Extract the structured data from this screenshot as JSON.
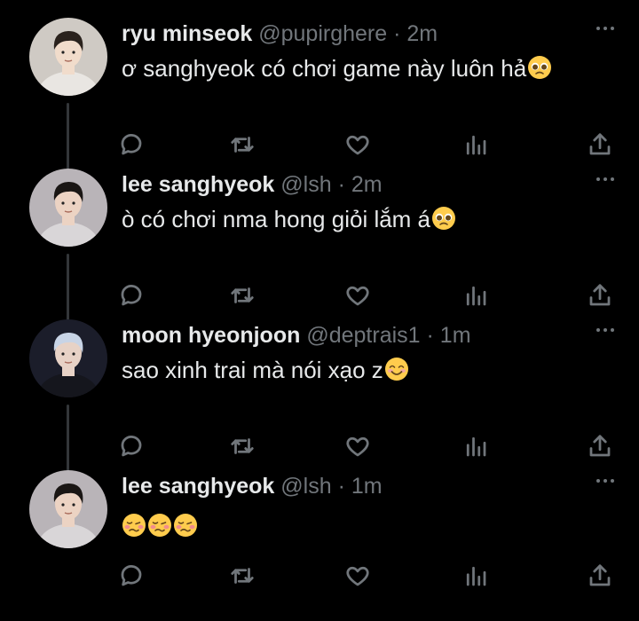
{
  "tweets": [
    {
      "display_name": "ryu minseok",
      "handle": "@pupirghere",
      "dot": "·",
      "time": "2m",
      "text": "ơ sanghyeok có chơi game này luôn hả",
      "emojis": [
        "pleading-face"
      ],
      "avatar_colors": {
        "bg": "#cfcac4",
        "hair": "#2a221d",
        "skin": "#f1dccb",
        "shirt": "#e9e6e2"
      }
    },
    {
      "display_name": "lee sanghyeok",
      "handle": "@lsh",
      "dot": "·",
      "time": "2m",
      "text": "ò có chơi nma hong giỏi lắm á",
      "emojis": [
        "pleading-face"
      ],
      "avatar_colors": {
        "bg": "#b9b4b8",
        "hair": "#1a1614",
        "skin": "#ecd3c3",
        "shirt": "#d9d6d8"
      }
    },
    {
      "display_name": "moon hyeonjoon",
      "handle": "@deptrais1",
      "dot": "·",
      "time": "1m",
      "text": "sao xinh trai mà nói xạo z",
      "emojis": [
        "smiling-face"
      ],
      "avatar_colors": {
        "bg": "#1b1d2a",
        "hair": "#c8d4e6",
        "skin": "#e7d2c6",
        "shirt": "#15161d"
      }
    },
    {
      "display_name": "lee sanghyeok",
      "handle": "@lsh",
      "dot": "·",
      "time": "1m",
      "text": "",
      "emojis": [
        "woozy-face",
        "woozy-face",
        "woozy-face"
      ],
      "avatar_colors": {
        "bg": "#b9b4b8",
        "hair": "#1a1614",
        "skin": "#ecd3c3",
        "shirt": "#d9d6d8"
      }
    }
  ],
  "action_icons": [
    "reply-icon",
    "retweet-icon",
    "like-icon",
    "analytics-icon",
    "share-icon"
  ],
  "colors": {
    "background": "#000000",
    "text": "#e7e9ea",
    "muted": "#71767b",
    "thread_line": "#333639"
  }
}
